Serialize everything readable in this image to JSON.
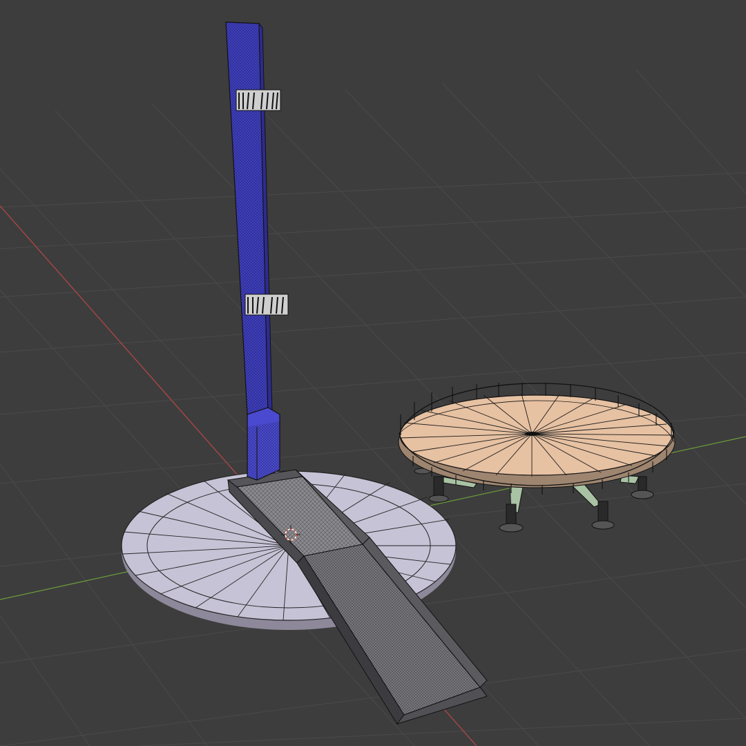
{
  "viewport": {
    "background": "#3d3d3d",
    "grid_color": "#4a4a4a",
    "x_axis_color": "#b34646",
    "y_axis_color": "#6c9a3c"
  },
  "objects": [
    {
      "name": "tower",
      "color": "#3f3fc0",
      "selected": true
    },
    {
      "name": "base-disc",
      "color": "#c7c3d6",
      "selected": false
    },
    {
      "name": "ramp",
      "color": "#6e6e72",
      "selected": false
    },
    {
      "name": "rotating-platform",
      "color": "#e6c1a2",
      "selected": false
    }
  ],
  "cursor": {
    "icon": "3d-cursor-icon"
  }
}
